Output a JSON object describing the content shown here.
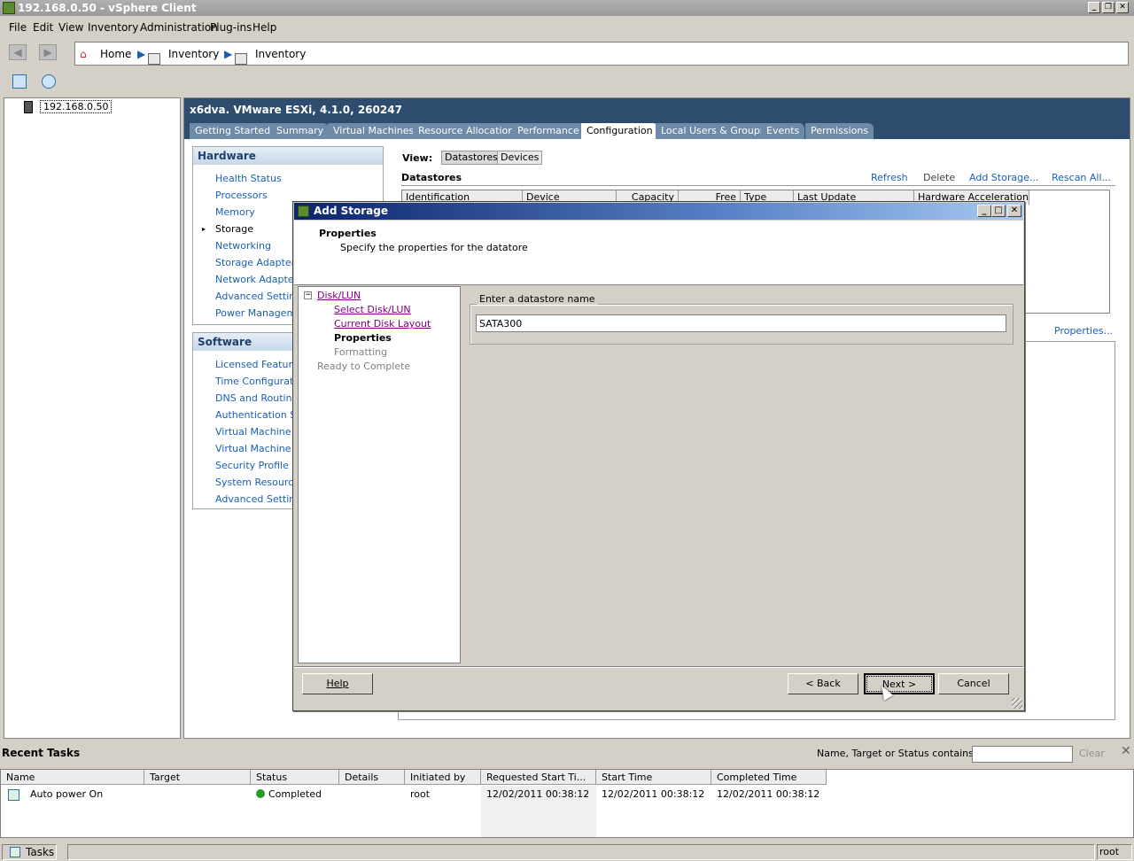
{
  "window": {
    "title": "192.168.0.50 - vSphere Client",
    "controls": [
      "minimize-icon",
      "restore-icon",
      "close-icon"
    ]
  },
  "menu": [
    "File",
    "Edit",
    "View",
    "Inventory",
    "Administration",
    "Plug-ins",
    "Help"
  ],
  "breadcrumb": [
    "Home",
    "Inventory",
    "Inventory"
  ],
  "tree": {
    "node": "192.168.0.50"
  },
  "host": {
    "title": "x6dva. VMware ESXi, 4.1.0, 260247",
    "tabs": [
      "Getting Started",
      "Summary",
      "Virtual Machines",
      "Resource Allocation",
      "Performance",
      "Configuration",
      "Local Users & Groups",
      "Events",
      "Permissions"
    ],
    "active_tab": "Configuration"
  },
  "hardware": {
    "heading": "Hardware",
    "items": [
      "Health Status",
      "Processors",
      "Memory",
      "Storage",
      "Networking",
      "Storage Adapters",
      "Network Adapters",
      "Advanced Settings",
      "Power Management"
    ],
    "selected": "Storage"
  },
  "software": {
    "heading": "Software",
    "items": [
      "Licensed Features",
      "Time Configuration",
      "DNS and Routing",
      "Authentication Services",
      "Virtual Machine Startup/Shutdown",
      "Virtual Machine Swapfile Location",
      "Security Profile",
      "System Resource Allocation",
      "Advanced Settings"
    ]
  },
  "view": {
    "label": "View:",
    "options": [
      "Datastores",
      "Devices"
    ],
    "selected": "Datastores"
  },
  "datastores": {
    "title": "Datastores",
    "actions": [
      "Refresh",
      "Delete",
      "Add Storage...",
      "Rescan All..."
    ],
    "columns": [
      "Identification",
      "Device",
      "Capacity",
      "Free",
      "Type",
      "Last Update",
      "Hardware Acceleration"
    ],
    "properties_link": "Properties..."
  },
  "dialog": {
    "title": "Add Storage",
    "page_title": "Properties",
    "page_subtitle": "Specify the properties for the datatore",
    "steps": {
      "root": "Disk/LUN",
      "select": "Select Disk/LUN",
      "layout": "Current Disk Layout",
      "properties": "Properties",
      "formatting": "Formatting",
      "ready": "Ready to Complete"
    },
    "group_label": "Enter a datastore name",
    "datastore_name": "SATA300",
    "buttons": {
      "help": "Help",
      "back": "< Back",
      "next": "Next >",
      "cancel": "Cancel"
    }
  },
  "tasks": {
    "title": "Recent Tasks",
    "filter_label": "Name, Target or Status contains: ▾",
    "filter_value": "",
    "clear": "Clear",
    "columns": [
      "Name",
      "Target",
      "Status",
      "Details",
      "Initiated by",
      "Requested Start Ti...",
      "Start Time",
      "Completed Time"
    ],
    "rows": [
      {
        "name": "Auto power On",
        "target": "",
        "status": "Completed",
        "details": "",
        "initiated_by": "root",
        "requested": "12/02/2011 00:38:12",
        "start": "12/02/2011 00:38:12",
        "completed": "12/02/2011 00:38:12"
      }
    ]
  },
  "statusbar": {
    "tasks_button": "Tasks",
    "user": "root"
  },
  "colors": {
    "header_bg": "#2d4c6e",
    "tab_bg": "#6d8aa8",
    "link": "#1a5fb4",
    "visited_link": "#800080",
    "dialog_title": "#0a246a"
  }
}
